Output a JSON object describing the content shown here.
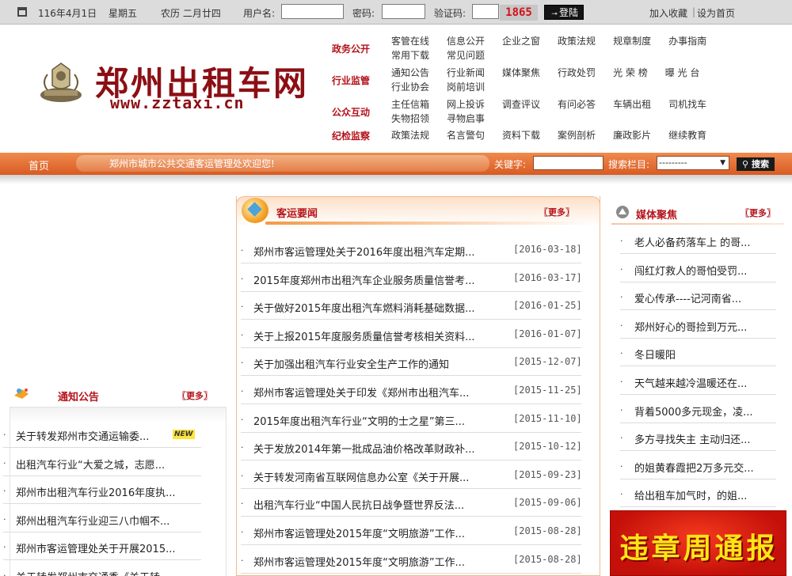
{
  "topbar": {
    "date": "116年4月1日",
    "weekday": "星期五",
    "lunar": "农历 二月廿四",
    "username_label": "用户名:",
    "password_label": "密码:",
    "captcha_label": "验证码:",
    "captcha_value": "1865",
    "login_label": "登陆",
    "bookmark_link": "加入收藏",
    "homepage_link": "设为首页",
    "separator": "|"
  },
  "header": {
    "site_name": "郑州出租车网",
    "site_url": "www.zztaxi.cn"
  },
  "nav": [
    {
      "group": "政务公开",
      "links": [
        "客管在线",
        "信息公开",
        "企业之窗",
        "政策法规",
        "规章制度",
        "办事指南",
        "常用下载",
        "常见问题"
      ]
    },
    {
      "group": "行业监管",
      "links": [
        "通知公告",
        "行业新闻",
        "媒体聚焦",
        "行政处罚",
        "光 荣 榜",
        "曝 光 台",
        "行业协会",
        "岗前培训"
      ]
    },
    {
      "group": "公众互动",
      "links": [
        "主任信箱",
        "网上投诉",
        "调查评议",
        "有问必答",
        "车辆出租",
        "司机找车",
        "失物招领",
        "寻物启事"
      ]
    },
    {
      "group": "纪检监察",
      "links": [
        "政策法规",
        "名言警句",
        "资料下载",
        "案例剖析",
        "廉政影片",
        "继续教育"
      ]
    }
  ],
  "orange_bar": {
    "home": "首页",
    "welcome": "郑州市城市公共交通客运管理处欢迎您!",
    "keyword_label": "关键字:",
    "column_label": "搜索栏目:",
    "column_selected": "---------",
    "search_button": "搜索"
  },
  "center": {
    "title": "客运要闻",
    "more": "〖更多〗",
    "items": [
      {
        "title": "郑州市客运管理处关于2016年度出租汽车定期...",
        "date": "[2016-03-18]"
      },
      {
        "title": "2015年度郑州市出租汽车企业服务质量信誉考...",
        "date": "[2016-03-17]"
      },
      {
        "title": "关于做好2015年度出租汽车燃料消耗基础数据...",
        "date": "[2016-01-25]"
      },
      {
        "title": "关于上报2015年度服务质量信誉考核相关资料...",
        "date": "[2016-01-07]"
      },
      {
        "title": "关于加强出租汽车行业安全生产工作的通知",
        "date": "[2015-12-07]"
      },
      {
        "title": "郑州市客运管理处关于印发《郑州市出租汽车...",
        "date": "[2015-11-25]"
      },
      {
        "title": "2015年度出租汽车行业“文明的士之星”第三...",
        "date": "[2015-11-10]"
      },
      {
        "title": "关于发放2014年第一批成品油价格改革财政补...",
        "date": "[2015-10-12]"
      },
      {
        "title": "关于转发河南省互联网信息办公室《关于开展...",
        "date": "[2015-09-23]"
      },
      {
        "title": "出租汽车行业“中国人民抗日战争暨世界反法...",
        "date": "[2015-09-06]"
      },
      {
        "title": "郑州市客运管理处2015年度“文明旅游”工作...",
        "date": "[2015-08-28]"
      },
      {
        "title": "郑州市客运管理处2015年度“文明旅游”工作...",
        "date": "[2015-08-28]"
      }
    ]
  },
  "left": {
    "title": "通知公告",
    "more": "〖更多〗",
    "new_badge": "NEW",
    "items": [
      "关于转发郑州市交通运输委...",
      "出租汽车行业“大爱之城，志愿...",
      "郑州市出租汽车行业2016年度执...",
      "郑州出租汽车行业迎三八巾帼不...",
      "郑州市客运管理处关于开展2015...",
      "关于转发郑州市交通委《关于转..."
    ]
  },
  "right": {
    "title": "媒体聚焦",
    "more": "〖更多〗",
    "items": [
      "老人必备药落车上 的哥...",
      "闯红灯救人的哥怕受罚...",
      "爱心传承----记河南省...",
      "郑州好心的哥捡到万元...",
      "冬日暖阳",
      "天气越来越冷温暖还在...",
      "背着5000多元现金，凌...",
      "多方寻找失主 主动归还...",
      "的姐黄春霞把2万多元交...",
      "给出租车加气时，的姐..."
    ],
    "banner": "违章周通报"
  },
  "colors": {
    "brand_red": "#b4131b",
    "logo_red": "#8c0f14",
    "orange_bar": "#e06a30",
    "banner_red": "#d01810",
    "banner_yellow": "#ffe516"
  }
}
